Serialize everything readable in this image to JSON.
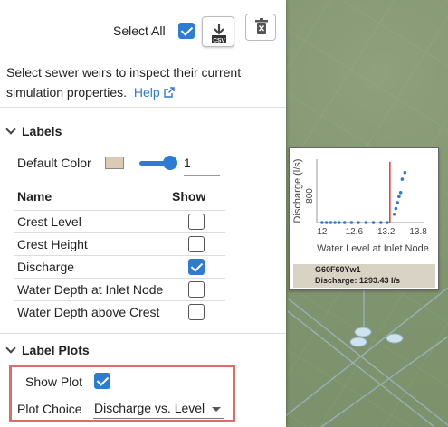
{
  "header": {
    "select_all_label": "Select All",
    "select_all_checked": true,
    "csv_button_text": "CSV"
  },
  "intro": {
    "text": "Select sewer weirs to inspect their current simulation properties.",
    "help_label": "Help"
  },
  "labels_section": {
    "title": "Labels",
    "default_color_label": "Default Color",
    "default_color": "#dccbb3",
    "size_value": "1",
    "columns": {
      "name": "Name",
      "show": "Show"
    },
    "rows": [
      {
        "label": "Crest Level",
        "checked": false
      },
      {
        "label": "Crest Height",
        "checked": false
      },
      {
        "label": "Discharge",
        "checked": true
      },
      {
        "label": "Water Depth at Inlet Node",
        "checked": false
      },
      {
        "label": "Water Depth above Crest",
        "checked": false
      }
    ]
  },
  "label_plots_section": {
    "title": "Label Plots",
    "show_plot_label": "Show Plot",
    "show_plot_checked": true,
    "plot_choice_label": "Plot Choice",
    "plot_choice_value": "Discharge vs. Level"
  },
  "colors": {
    "accent": "#2d7bd3",
    "highlight_box": "#e06a6a",
    "threshold_line": "#e0453a"
  },
  "popup": {
    "node_name": "G60F60Yw1",
    "discharge_text": "Discharge: 1293.43 l/s"
  },
  "chart_data": {
    "type": "scatter",
    "xlabel": "Water Level at Inlet Node",
    "ylabel": "Discharge (l/s)",
    "x_ticks": [
      "12",
      "12.6",
      "13.2",
      "13.8"
    ],
    "y_ticks": [
      "800"
    ],
    "xlim": [
      11.9,
      13.9
    ],
    "ylim": [
      0,
      1900
    ],
    "vline_x": 13.27,
    "series": [
      {
        "x": [
          12.0,
          12.08,
          12.16,
          12.24,
          12.32,
          12.42,
          12.55,
          12.68,
          12.82,
          12.96,
          13.1,
          13.22,
          13.35,
          13.38,
          13.41,
          13.44,
          13.47,
          13.5,
          13.55
        ],
        "y": [
          0,
          0,
          0,
          0,
          0,
          0,
          0,
          0,
          0,
          0,
          0,
          0,
          250,
          420,
          600,
          780,
          900,
          1300,
          1500
        ]
      }
    ]
  }
}
